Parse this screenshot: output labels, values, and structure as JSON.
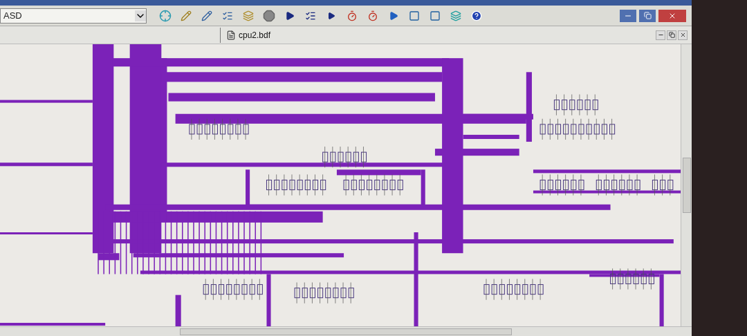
{
  "toolbar": {
    "project_selector": {
      "value": "ASD"
    }
  },
  "document_tab": {
    "label": "cpu2.bdf"
  }
}
